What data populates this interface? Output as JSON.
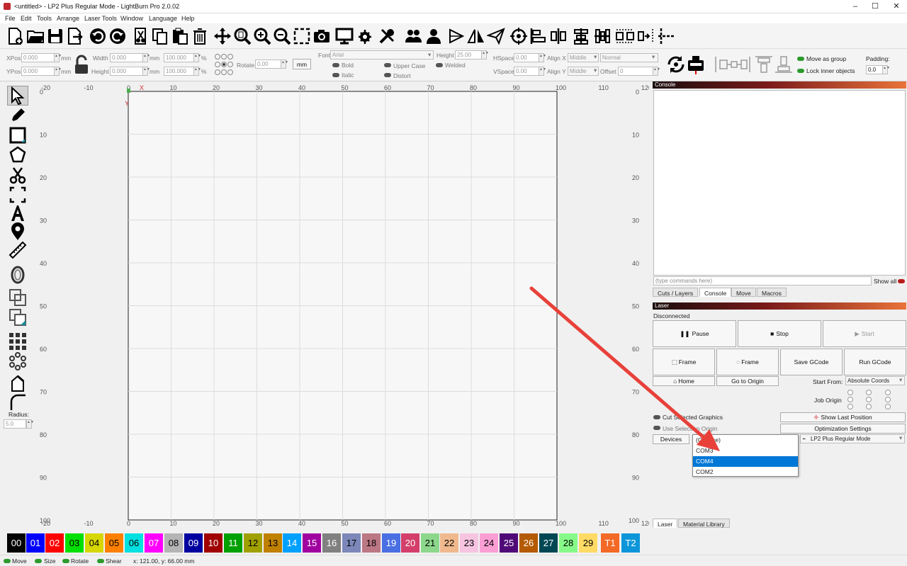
{
  "window": {
    "title": "<untitled> - LP2 Plus Regular Mode - LightBurn Pro 2.0.02",
    "min": "–",
    "max": "☐",
    "close": "✕"
  },
  "menu": [
    "File",
    "Edit",
    "Tools",
    "Arrange",
    "Laser Tools",
    "Window",
    "Language",
    "Help"
  ],
  "props": {
    "xpos_label": "XPos",
    "xpos": "0.000",
    "ypos_label": "YPos",
    "ypos": "0.000",
    "unit": "mm",
    "width_label": "Width",
    "width": "0.000",
    "height_label": "Height",
    "height": "0.000",
    "pct_w": "100.000",
    "pct_h": "100.000",
    "pct": "%",
    "rotate_label": "Rotate",
    "rotate": "0.00",
    "mm_button": "mm",
    "font_label": "Font",
    "font": "Arial",
    "fheight_label": "Height",
    "fheight": "25.00",
    "hspace_label": "HSpace",
    "hspace": "0.00",
    "vspace_label": "VSpace",
    "vspace": "0.00",
    "alignx_label": "Align X",
    "alignx": "Middle",
    "aligny_label": "Align Y",
    "aligny": "Middle",
    "normal": "Normal",
    "offset_label": "Offset",
    "offset": "0",
    "bold": "Bold",
    "italic": "Italic",
    "upper": "Upper Case",
    "distort": "Distort",
    "welded": "Welded",
    "move_group": "Move as group",
    "lock_inner": "Lock inner objects",
    "padding_label": "Padding:",
    "padding": "0.0"
  },
  "left_tools": {
    "radius_label": "Radius:",
    "radius": "5.0"
  },
  "ruler": {
    "top": [
      "-20",
      "-10",
      "0",
      "10",
      "20",
      "30",
      "40",
      "50",
      "60",
      "70",
      "80",
      "90",
      "100",
      "110",
      "120"
    ],
    "left": [
      "0",
      "10",
      "20",
      "30",
      "40",
      "50",
      "60",
      "70",
      "80",
      "90",
      "100"
    ],
    "x_axis": "X",
    "y_axis": "Y"
  },
  "console": {
    "title": "Console",
    "placeholder": "(type commands here)",
    "show_all": "Show all",
    "tabs": [
      "Cuts / Layers",
      "Console",
      "Move",
      "Macros"
    ]
  },
  "laser": {
    "title": "Laser",
    "status": "Disconnected",
    "pause": "Pause",
    "stop": "Stop",
    "start": "Start",
    "frame1": "Frame",
    "frame2": "Frame",
    "save_gcode": "Save GCode",
    "run_gcode": "Run GCode",
    "home": "Home",
    "go_origin": "Go to Origin",
    "start_from_label": "Start From:",
    "start_from": "Absolute Coords",
    "job_origin": "Job Origin",
    "cut_selected": "Cut Selected Graphics",
    "use_selection": "Use Selection Origin",
    "show_last": "Show Last Position",
    "optimization": "Optimization Settings",
    "devices": "Devices",
    "device_name": "LP2 Plus Regular Mode",
    "port_options": [
      "(Choose)",
      "COM3",
      "COM4",
      "COM2"
    ],
    "port_selected": "COM4",
    "bottom_tabs": [
      "Laser",
      "Material Library"
    ]
  },
  "palette": [
    {
      "label": "00",
      "color": "#000000",
      "text": "#ffffff"
    },
    {
      "label": "01",
      "color": "#0000ff",
      "text": "#ffffff"
    },
    {
      "label": "02",
      "color": "#ff0000",
      "text": "#ffffff"
    },
    {
      "label": "03",
      "color": "#00e000",
      "text": "#000000"
    },
    {
      "label": "04",
      "color": "#d6d600",
      "text": "#000000"
    },
    {
      "label": "05",
      "color": "#ff8000",
      "text": "#000000"
    },
    {
      "label": "06",
      "color": "#00e0e0",
      "text": "#000000"
    },
    {
      "label": "07",
      "color": "#ff00ff",
      "text": "#ffffff"
    },
    {
      "label": "08",
      "color": "#b4b4b4",
      "text": "#000000"
    },
    {
      "label": "09",
      "color": "#0000a0",
      "text": "#ffffff"
    },
    {
      "label": "10",
      "color": "#a00000",
      "text": "#ffffff"
    },
    {
      "label": "11",
      "color": "#00a000",
      "text": "#ffffff"
    },
    {
      "label": "12",
      "color": "#a0a000",
      "text": "#000000"
    },
    {
      "label": "13",
      "color": "#c08000",
      "text": "#000000"
    },
    {
      "label": "14",
      "color": "#00a0ff",
      "text": "#ffffff"
    },
    {
      "label": "15",
      "color": "#a000a0",
      "text": "#ffffff"
    },
    {
      "label": "16",
      "color": "#808080",
      "text": "#ffffff"
    },
    {
      "label": "17",
      "color": "#7d87b9",
      "text": "#000000"
    },
    {
      "label": "18",
      "color": "#bb7784",
      "text": "#000000"
    },
    {
      "label": "19",
      "color": "#4a6fe3",
      "text": "#ffffff"
    },
    {
      "label": "20",
      "color": "#d33f6a",
      "text": "#ffffff"
    },
    {
      "label": "21",
      "color": "#8cd78c",
      "text": "#000000"
    },
    {
      "label": "22",
      "color": "#f0b98d",
      "text": "#000000"
    },
    {
      "label": "23",
      "color": "#f6c4e1",
      "text": "#000000"
    },
    {
      "label": "24",
      "color": "#fa9ed4",
      "text": "#000000"
    },
    {
      "label": "25",
      "color": "#500a78",
      "text": "#ffffff"
    },
    {
      "label": "26",
      "color": "#b45a00",
      "text": "#ffffff"
    },
    {
      "label": "27",
      "color": "#004754",
      "text": "#ffffff"
    },
    {
      "label": "28",
      "color": "#86fa88",
      "text": "#000000"
    },
    {
      "label": "29",
      "color": "#ffdb66",
      "text": "#000000"
    },
    {
      "label": "T1",
      "color": "#f36926",
      "text": "#ffffff"
    },
    {
      "label": "T2",
      "color": "#0c96d9",
      "text": "#ffffff"
    }
  ],
  "status": {
    "move": "Move",
    "size": "Size",
    "rotate": "Rotate",
    "shear": "Shear",
    "coords": "x: 121.00, y: 66.00 mm"
  },
  "colors": {
    "accent": "#0078d7",
    "arrow": "#e8413a"
  }
}
